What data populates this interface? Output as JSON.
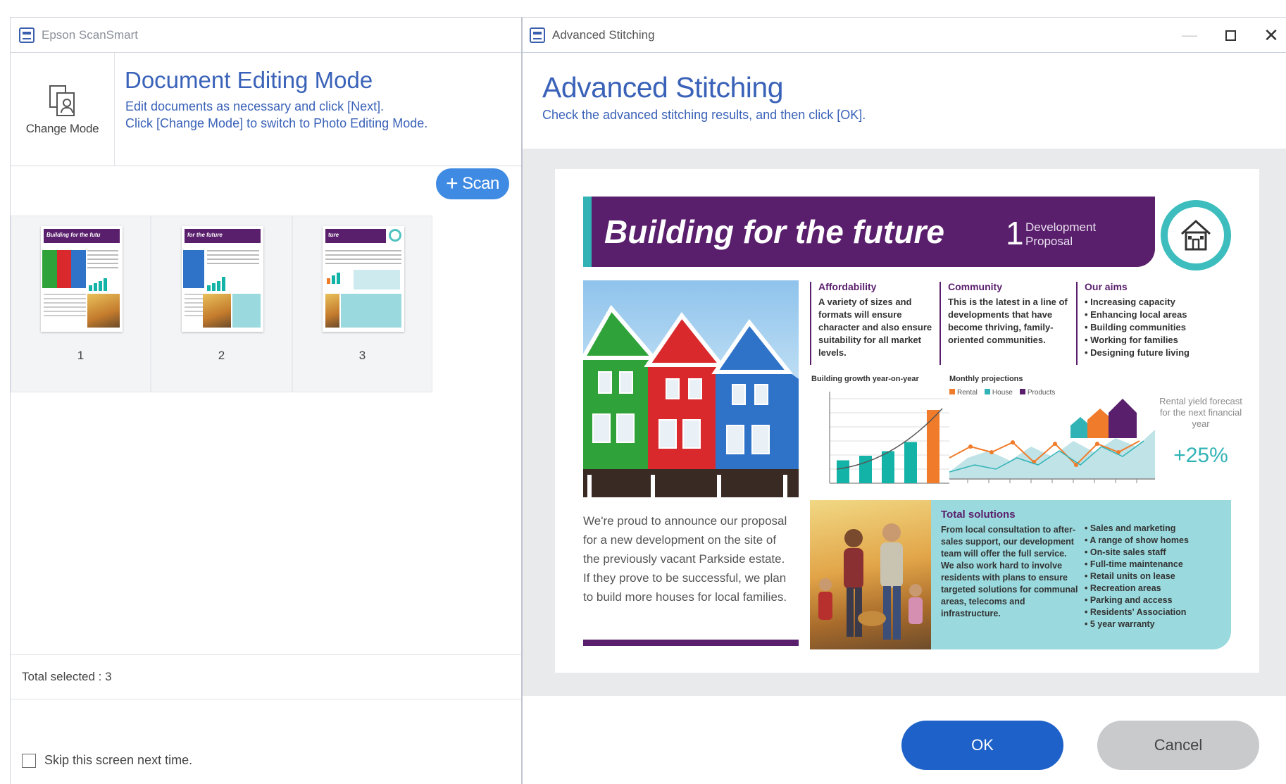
{
  "left_window": {
    "title": "Epson ScanSmart",
    "change_mode_label": "Change Mode",
    "mode_title": "Document Editing Mode",
    "mode_desc_line1": "Edit documents as necessary and click [Next].",
    "mode_desc_line2": "Click [Change Mode] to switch to Photo Editing Mode.",
    "scan_button_label": "Scan",
    "thumbnails": [
      {
        "number": "1",
        "band_text": "Building for the futu"
      },
      {
        "number": "2",
        "band_text": "for the future"
      },
      {
        "number": "3",
        "band_text": "ture"
      }
    ],
    "total_selected": "Total selected : 3",
    "skip_label": "Skip this screen next time."
  },
  "right_window": {
    "title": "Advanced Stitching",
    "heading": "Advanced Stitching",
    "description": "Check the advanced stitching results, and then click [OK].",
    "ok_label": "OK",
    "cancel_label": "Cancel"
  },
  "document": {
    "title": "Building for the future",
    "section_number": "1",
    "section_label_line1": "Development",
    "section_label_line2": "Proposal",
    "affordability_head": "Affordability",
    "affordability_text": "A variety of sizes and formats will ensure character and also ensure suitability for all market levels.",
    "community_head": "Community",
    "community_text": "This is the latest in a line of developments that have become thriving, family-oriented communities.",
    "aims_head": "Our aims",
    "aims": [
      "• Increasing capacity",
      "• Enhancing local areas",
      "• Building communities",
      "• Working for families",
      "• Designing future living"
    ],
    "chart1_label": "Building growth year-on-year",
    "chart1_values": [
      25,
      30,
      35,
      45,
      80
    ],
    "chart2_label": "Monthly projections",
    "chart2_legend": [
      "Rental",
      "House",
      "Products"
    ],
    "forecast_text": "Rental yield forecast for the next financial year",
    "forecast_pct": "+25%",
    "body_text": "We're proud to announce our proposal for a new development on the site of the previously vacant Parkside estate. If they prove to be successful, we plan to build more houses for local families.",
    "total_solutions_head": "Total solutions",
    "total_solutions_text": "From local consultation to after-sales support, our development team will offer the full service. We also work hard to involve residents with plans to ensure targeted solutions for communal areas, telecoms and infrastructure.",
    "services": [
      "• Sales and marketing",
      "• A range of show homes",
      "• On-site sales staff",
      "• Full-time maintenance",
      "• Retail units on lease",
      "• Recreation areas",
      "• Parking and access",
      "• Residents' Association",
      "• 5 year warranty"
    ]
  },
  "colors": {
    "accent_blue": "#3a62b8",
    "scan_button": "#3f8be3",
    "ok_button": "#1d61c9",
    "cancel_button": "#c9cacc",
    "brochure_purple": "#5a1f6c",
    "brochure_teal": "#31b3b6"
  },
  "icons": {
    "app": "scanner-app-icon",
    "change_mode": "change-mode-icon",
    "scan_plus": "plus-icon",
    "close": "close-icon",
    "maximize": "maximize-icon",
    "minimize": "minimize-icon"
  }
}
